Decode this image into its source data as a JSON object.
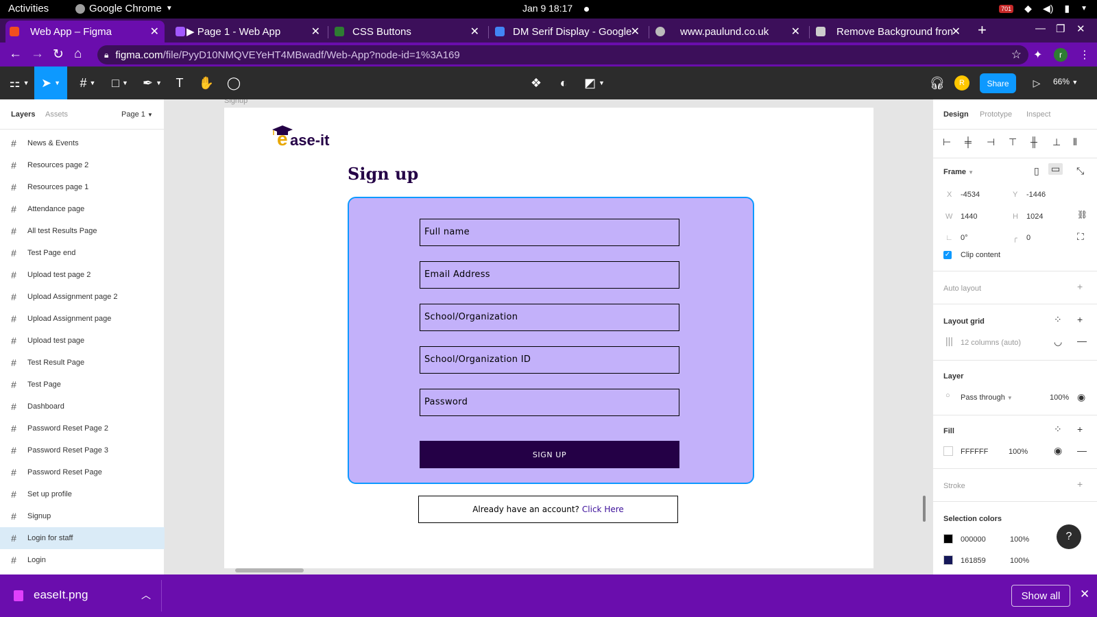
{
  "system_bar": {
    "activities": "Activities",
    "app_name": "Google Chrome",
    "clock": "Jan 9  18:17",
    "badge": "701"
  },
  "browser": {
    "tabs": [
      {
        "label": "Web App – Figma",
        "favicon": "figma-icon",
        "active": true
      },
      {
        "label": "▶ Page 1 - Web App",
        "favicon": "figma-icon",
        "active": false
      },
      {
        "label": "CSS Buttons",
        "favicon": "w-icon",
        "active": false
      },
      {
        "label": "DM Serif Display - Google",
        "favicon": "google-fonts-icon",
        "active": false
      },
      {
        "label": "www.paulund.co.uk",
        "favicon": "globe-icon",
        "active": false
      },
      {
        "label": "Remove Background fron",
        "favicon": "layers-icon",
        "active": false
      }
    ],
    "url_host": "figma.com",
    "url_path": "/file/PyyD10NMQVEYeHT4MBwadf/Web-App?node-id=1%3A169",
    "profile_initial": "r"
  },
  "figma_toolbar": {
    "share_label": "Share",
    "user_initial": "R",
    "zoom": "66%"
  },
  "left_panel": {
    "tab_layers": "Layers",
    "tab_assets": "Assets",
    "page_selector": "Page 1",
    "layers": [
      "News & Events",
      "Resources page 2",
      "Resources page 1",
      "Attendance page",
      "All test Results Page",
      "Test Page end",
      "Upload test page 2",
      "Upload Assignment page 2",
      "Upload Assignment page",
      "Upload test page",
      "Test Result Page",
      "Test Page",
      "Dashboard",
      "Password Reset Page 2",
      "Password Reset Page 3",
      "Password Reset Page",
      "Set up profile",
      "Signup",
      "Login for staff",
      "Login"
    ],
    "selected_layer": "Login for staff"
  },
  "canvas": {
    "frame_label": "Signup",
    "logo_e": "e",
    "logo_rest": "ase-it",
    "page_title": "Sign up",
    "fields": [
      "Full name",
      "Email Address",
      "School/Organization",
      "School/Organization ID",
      "Password"
    ],
    "signup_button": "SIGN UP",
    "account_text": "Already have an account?",
    "account_link": "Click Here"
  },
  "right_panel": {
    "tab_design": "Design",
    "tab_prototype": "Prototype",
    "tab_inspect": "Inspect",
    "frame_title": "Frame",
    "x_label": "X",
    "x_value": "-4534",
    "y_label": "Y",
    "y_value": "-1446",
    "w_label": "W",
    "w_value": "1440",
    "h_label": "H",
    "h_value": "1024",
    "rotation": "0°",
    "radius": "0",
    "clip_content": "Clip content",
    "auto_layout": "Auto layout",
    "layout_grid": "Layout grid",
    "grid_value": "12 columns (auto)",
    "layer_title": "Layer",
    "blend_mode": "Pass through",
    "layer_opacity": "100%",
    "fill_title": "Fill",
    "fill_hex": "FFFFFF",
    "fill_opacity": "100%",
    "stroke_title": "Stroke",
    "selection_colors_title": "Selection colors",
    "selection_colors": [
      {
        "hex": "000000",
        "opacity": "100%",
        "color": "#000000"
      },
      {
        "hex": "161859",
        "opacity": "100%",
        "color": "#161859"
      }
    ]
  },
  "download_bar": {
    "file_name": "easeIt.png",
    "show_all": "Show all"
  },
  "colors": {
    "accent_purple": "#6a0dad",
    "figma_blue": "#0d99ff",
    "form_card": "#c3b1fa",
    "brand_dark": "#240046"
  }
}
